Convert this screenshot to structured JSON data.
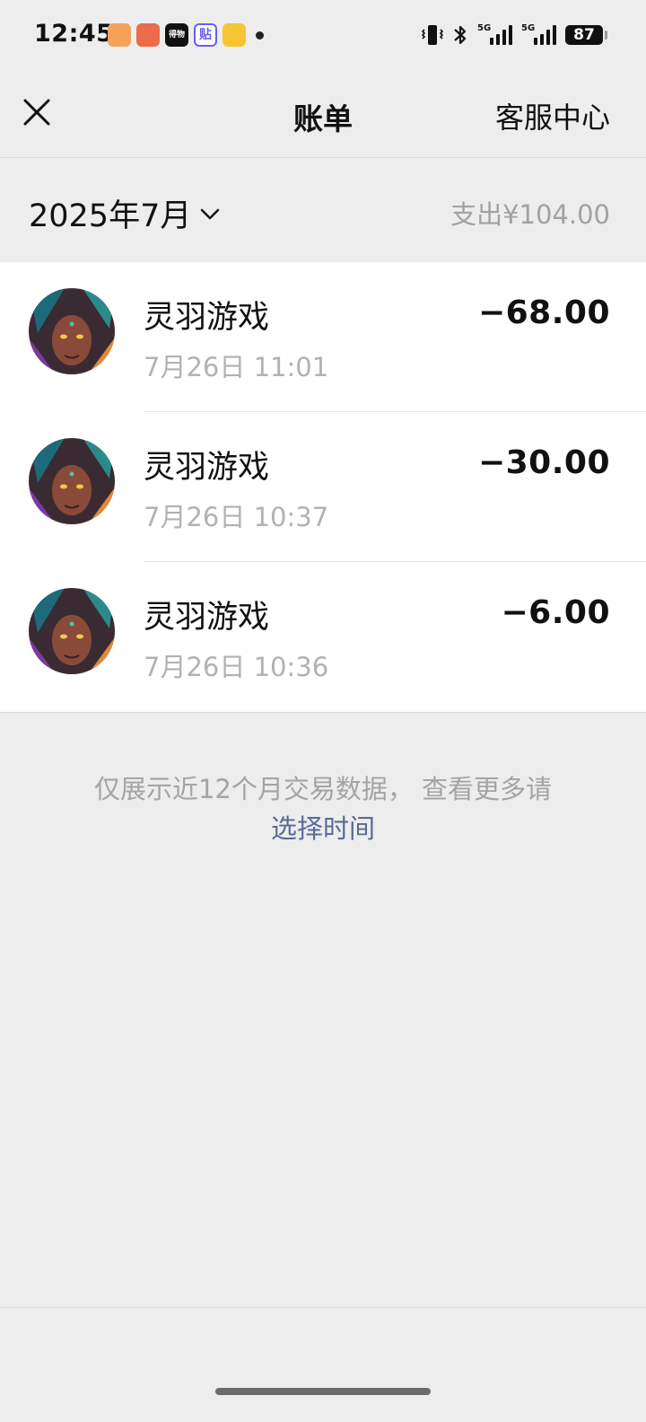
{
  "status_bar": {
    "time": "12:45",
    "app_icon_2_text": "得物",
    "app_icon_3_text": "贴",
    "network_1": "5G",
    "network_2": "5G",
    "battery": "87"
  },
  "nav": {
    "title": "账单",
    "service_center": "客服中心",
    "close_icon": "close-icon"
  },
  "month_header": {
    "month": "2025年7月",
    "spend_summary": "支出¥104.00"
  },
  "bills": [
    {
      "merchant": "灵羽游戏",
      "time": "7月26日 11:01",
      "amount": "−68.00"
    },
    {
      "merchant": "灵羽游戏",
      "time": "7月26日 10:37",
      "amount": "−30.00"
    },
    {
      "merchant": "灵羽游戏",
      "time": "7月26日 10:36",
      "amount": "−6.00"
    }
  ],
  "footer": {
    "note": "仅展示近12个月交易数据， 查看更多请",
    "link": "选择时间"
  },
  "colors": {
    "background": "#ededed",
    "link": "#576b95",
    "secondary_text": "#a2a2a2"
  }
}
